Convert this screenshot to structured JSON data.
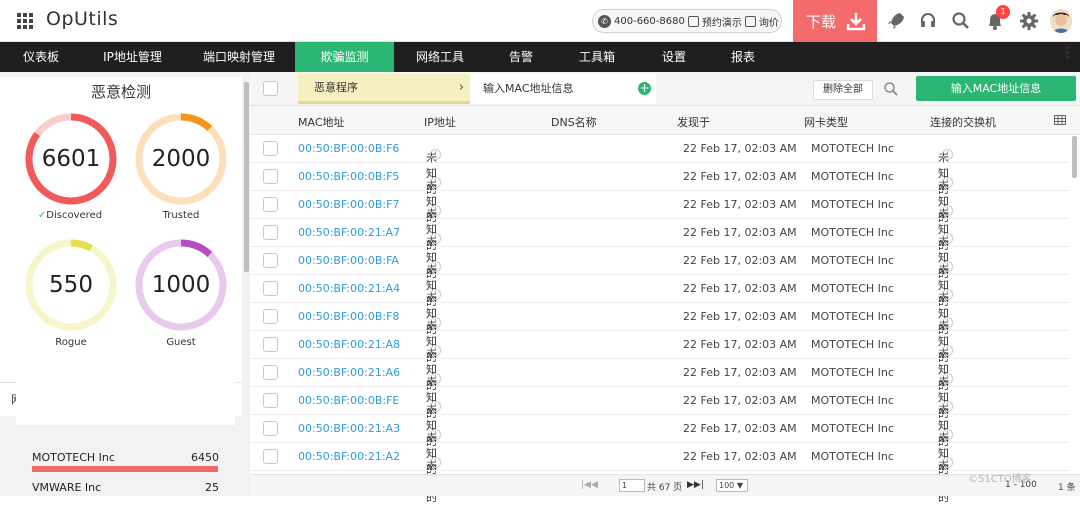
{
  "app": {
    "title": "OpUtils"
  },
  "header": {
    "phone": "400-660-8680",
    "demo": "预约演示",
    "inquiry": "询价",
    "download": "下载",
    "notification_count": "1"
  },
  "nav": {
    "items": [
      {
        "label": "仪表板",
        "active": false
      },
      {
        "label": "IP地址管理",
        "active": false
      },
      {
        "label": "端口映射管理",
        "active": false
      },
      {
        "label": "欺骗监测",
        "active": true
      },
      {
        "label": "网络工具",
        "active": false
      },
      {
        "label": "告警",
        "active": false
      },
      {
        "label": "工具箱",
        "active": false
      },
      {
        "label": "设置",
        "active": false
      },
      {
        "label": "报表",
        "active": false
      }
    ]
  },
  "sidebar": {
    "title": "恶意检测",
    "gauges": [
      {
        "value": "6601",
        "label": "Discovered",
        "color": "#f05a5a",
        "fill": 0.85,
        "check": true
      },
      {
        "value": "2000",
        "label": "Trusted",
        "color": "#f7941d",
        "fill": 0.12,
        "check": false
      },
      {
        "value": "550",
        "label": "Rogue",
        "color": "#e4e050",
        "fill": 0.08,
        "check": false
      },
      {
        "value": "1000",
        "label": "Guest",
        "color": "#b34fbf",
        "fill": 0.12,
        "check": false
      }
    ],
    "nic_tab": "网卡类型",
    "nic_list": [
      {
        "vendor": "MOTOTECH Inc",
        "count": "6450"
      },
      {
        "vendor": "VMWARE Inc",
        "count": "25"
      }
    ]
  },
  "toolbar": {
    "submenu_active": "恶意程序",
    "submenu_secondary": "输入MAC地址信息",
    "delete_all": "删除全部",
    "add_button": "输入MAC地址信息"
  },
  "table": {
    "columns": [
      "MAC地址",
      "IP地址",
      "DNS名称",
      "发现于",
      "网卡类型",
      "连接的交换机"
    ],
    "rows": [
      {
        "mac": "00:50:BF:00:0B:F6",
        "ip": "未知的",
        "dns": "",
        "found": "22 Feb 17, 02:03 AM",
        "vendor": "MOTOTECH Inc",
        "switch": "未知的"
      },
      {
        "mac": "00:50:BF:00:0B:F5",
        "ip": "未知的",
        "dns": "",
        "found": "22 Feb 17, 02:03 AM",
        "vendor": "MOTOTECH Inc",
        "switch": "未知的"
      },
      {
        "mac": "00:50:BF:00:0B:F7",
        "ip": "未知的",
        "dns": "",
        "found": "22 Feb 17, 02:03 AM",
        "vendor": "MOTOTECH Inc",
        "switch": "未知的"
      },
      {
        "mac": "00:50:BF:00:21:A7",
        "ip": "未知的",
        "dns": "",
        "found": "22 Feb 17, 02:03 AM",
        "vendor": "MOTOTECH Inc",
        "switch": "未知的"
      },
      {
        "mac": "00:50:BF:00:0B:FA",
        "ip": "未知的",
        "dns": "",
        "found": "22 Feb 17, 02:03 AM",
        "vendor": "MOTOTECH Inc",
        "switch": "未知的"
      },
      {
        "mac": "00:50:BF:00:21:A4",
        "ip": "未知的",
        "dns": "",
        "found": "22 Feb 17, 02:03 AM",
        "vendor": "MOTOTECH Inc",
        "switch": "未知的"
      },
      {
        "mac": "00:50:BF:00:0B:F8",
        "ip": "未知的",
        "dns": "",
        "found": "22 Feb 17, 02:03 AM",
        "vendor": "MOTOTECH Inc",
        "switch": "未知的"
      },
      {
        "mac": "00:50:BF:00:21:A8",
        "ip": "未知的",
        "dns": "",
        "found": "22 Feb 17, 02:03 AM",
        "vendor": "MOTOTECH Inc",
        "switch": "未知的"
      },
      {
        "mac": "00:50:BF:00:21:A6",
        "ip": "未知的",
        "dns": "",
        "found": "22 Feb 17, 02:03 AM",
        "vendor": "MOTOTECH Inc",
        "switch": "未知的"
      },
      {
        "mac": "00:50:BF:00:0B:FE",
        "ip": "未知的",
        "dns": "",
        "found": "22 Feb 17, 02:03 AM",
        "vendor": "MOTOTECH Inc",
        "switch": "未知的"
      },
      {
        "mac": "00:50:BF:00:21:A3",
        "ip": "未知的",
        "dns": "",
        "found": "22 Feb 17, 02:03 AM",
        "vendor": "MOTOTECH Inc",
        "switch": "未知的"
      },
      {
        "mac": "00:50:BF:00:21:A2",
        "ip": "未知的",
        "dns": "",
        "found": "22 Feb 17, 02:03 AM",
        "vendor": "MOTOTECH Inc",
        "switch": "未知的"
      }
    ]
  },
  "pager": {
    "page": "1",
    "of_pages": "共 67 页",
    "page_size": "100 ▼",
    "range_start": "1 - 100",
    "range_end": "1 条"
  },
  "watermark": "©51CTO博客",
  "colors": {
    "accent": "#2bb673",
    "download": "#f36b6b",
    "link": "#2d9cdb",
    "navbar": "#1f1f1f"
  }
}
